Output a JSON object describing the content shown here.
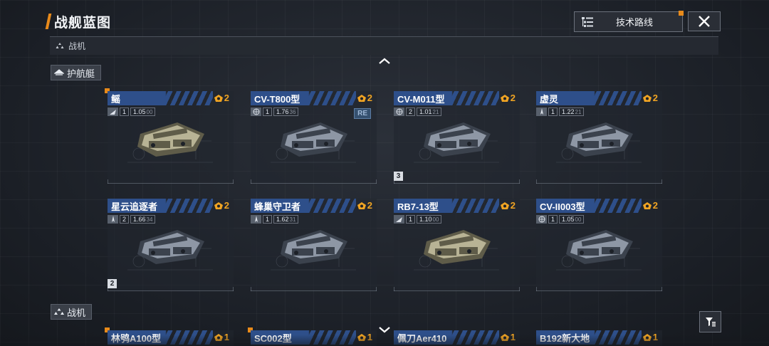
{
  "colors": {
    "accent": "#e88a1a",
    "plate_blue": "#2e4f8a",
    "count_gold": "#f0a423"
  },
  "header": {
    "title": "战舰蓝图",
    "tech_route_label": "技术路线",
    "close_icon": "close-icon"
  },
  "category": {
    "label": "战机"
  },
  "sections": [
    {
      "label": "护航艇",
      "cards": [
        {
          "name": "鳐",
          "count": "2",
          "type_icon": "fighter-icon",
          "tier": "1",
          "ver_main": "1.05",
          "ver_sub": "00",
          "new": true,
          "re": "",
          "level": ""
        },
        {
          "name": "CV-T800型",
          "count": "2",
          "type_icon": "globe-icon",
          "tier": "1",
          "ver_main": "1.76",
          "ver_sub": "36",
          "new": false,
          "re": "RE",
          "level": ""
        },
        {
          "name": "CV-M011型",
          "count": "2",
          "type_icon": "globe-icon",
          "tier": "2",
          "ver_main": "1.01",
          "ver_sub": "21",
          "new": false,
          "re": "",
          "level": "3"
        },
        {
          "name": "虚灵",
          "count": "2",
          "type_icon": "jet-icon",
          "tier": "1",
          "ver_main": "1.22",
          "ver_sub": "21",
          "new": false,
          "re": "",
          "level": ""
        },
        {
          "name": "星云追逐者",
          "count": "2",
          "type_icon": "jet-icon",
          "tier": "2",
          "ver_main": "1.66",
          "ver_sub": "34",
          "new": false,
          "re": "",
          "level": "2"
        },
        {
          "name": "蜂巢守卫者",
          "count": "2",
          "type_icon": "jet-icon",
          "tier": "1",
          "ver_main": "1.62",
          "ver_sub": "31",
          "new": false,
          "re": "",
          "level": ""
        },
        {
          "name": "RB7-13型",
          "count": "2",
          "type_icon": "fighter-icon",
          "tier": "1",
          "ver_main": "1.10",
          "ver_sub": "00",
          "new": false,
          "re": "",
          "level": ""
        },
        {
          "name": "CV-II003型",
          "count": "2",
          "type_icon": "globe-icon",
          "tier": "1",
          "ver_main": "1.05",
          "ver_sub": "00",
          "new": false,
          "re": "",
          "level": ""
        }
      ]
    },
    {
      "label": "战机",
      "cards": [
        {
          "name": "林鸮A100型",
          "count": "1",
          "new": true
        },
        {
          "name": "SC002型",
          "count": "1",
          "new": true
        },
        {
          "name": "佩刀Aer410",
          "count": "1",
          "new": false
        },
        {
          "name": "B192新大地",
          "count": "1",
          "new": false
        }
      ]
    }
  ]
}
